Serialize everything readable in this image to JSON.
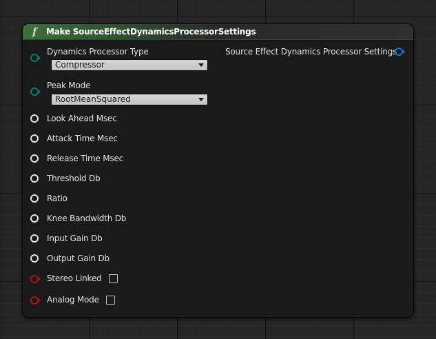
{
  "node": {
    "title": "Make SourceEffectDynamicsProcessorSettings",
    "function_icon": "f"
  },
  "output": {
    "label": "Source Effect Dynamics Processor Settings"
  },
  "inputs": {
    "dynamics_processor_type": {
      "label": "Dynamics Processor Type",
      "value": "Compressor"
    },
    "peak_mode": {
      "label": "Peak Mode",
      "value": "RootMeanSquared"
    },
    "look_ahead_msec": {
      "label": "Look Ahead Msec"
    },
    "attack_time_msec": {
      "label": "Attack Time Msec"
    },
    "release_time_msec": {
      "label": "Release Time Msec"
    },
    "threshold_db": {
      "label": "Threshold Db"
    },
    "ratio": {
      "label": "Ratio"
    },
    "knee_bandwidth_db": {
      "label": "Knee Bandwidth Db"
    },
    "input_gain_db": {
      "label": "Input Gain Db"
    },
    "output_gain_db": {
      "label": "Output Gain Db"
    },
    "stereo_linked": {
      "label": "Stereo Linked",
      "checked": false
    },
    "analog_mode": {
      "label": "Analog Mode",
      "checked": false
    }
  },
  "colors": {
    "header_accent": "#3d6f3c",
    "float_pin": "#e8e8e8",
    "enum_pin": "#0a7a6c",
    "bool_pin": "#a61419",
    "struct_pin": "#1f74d8"
  }
}
